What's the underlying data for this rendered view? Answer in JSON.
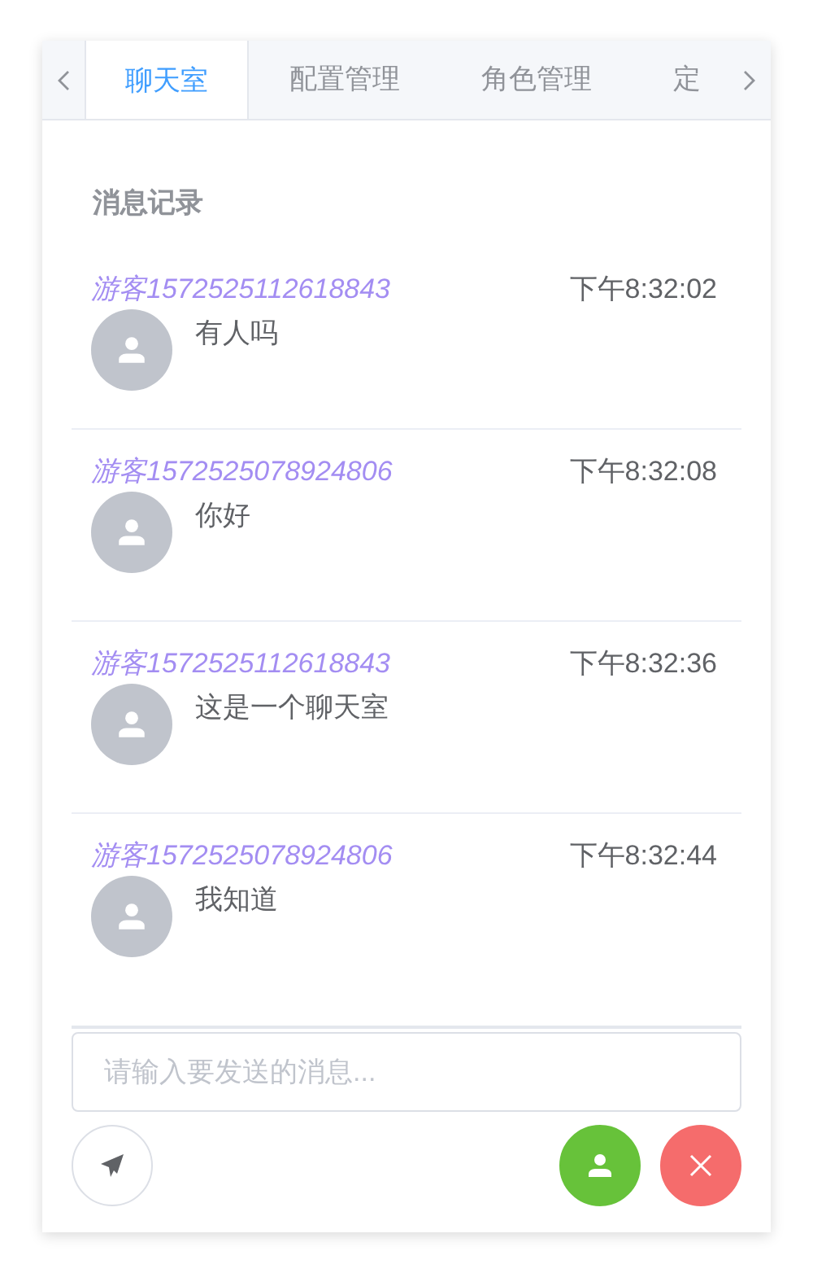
{
  "tabs": [
    {
      "label": "聊天室",
      "selected": true
    },
    {
      "label": "配置管理",
      "selected": false
    },
    {
      "label": "角色管理",
      "selected": false
    },
    {
      "label": "定",
      "selected": false
    }
  ],
  "section_title": "消息记录",
  "messages": [
    {
      "user": "游客1572525112618843",
      "time": "下午8:32:02",
      "text": "有人吗"
    },
    {
      "user": "游客1572525078924806",
      "time": "下午8:32:08",
      "text": "你好"
    },
    {
      "user": "游客1572525112618843",
      "time": "下午8:32:36",
      "text": "这是一个聊天室"
    },
    {
      "user": "游客1572525078924806",
      "time": "下午8:32:44",
      "text": "我知道"
    }
  ],
  "input": {
    "placeholder": "请输入要发送的消息..."
  }
}
